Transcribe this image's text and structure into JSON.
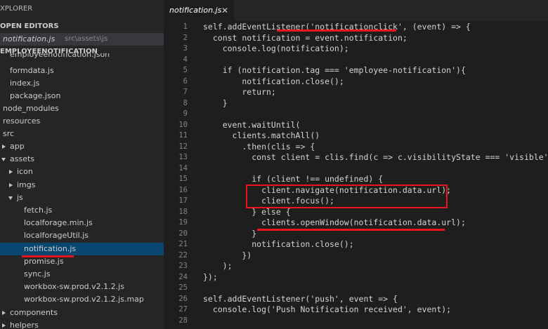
{
  "sidebar": {
    "explorer_title": "XPLORER",
    "open_editors_title": "OPEN EDITORS",
    "open_file": {
      "name": "notification.js",
      "path": "src\\assets\\js"
    },
    "project_title": "EMPLOYEENOTIFICATION",
    "items": [
      {
        "label": "employeenotification.json"
      },
      {
        "label": "formdata.js"
      },
      {
        "label": "index.js"
      },
      {
        "label": "package.json"
      },
      {
        "label": "node_modules"
      },
      {
        "label": "resources"
      },
      {
        "label": "src"
      },
      {
        "label": "app"
      },
      {
        "label": "assets"
      },
      {
        "label": "icon"
      },
      {
        "label": "imgs"
      },
      {
        "label": "js"
      },
      {
        "label": "fetch.js"
      },
      {
        "label": "localforage.min.js"
      },
      {
        "label": "localforageUtil.js"
      },
      {
        "label": "notification.js"
      },
      {
        "label": "promise.js"
      },
      {
        "label": "sync.js"
      },
      {
        "label": "workbox-sw.prod.v2.1.2.js"
      },
      {
        "label": "workbox-sw.prod.v2.1.2.js.map"
      },
      {
        "label": "components"
      },
      {
        "label": "helpers"
      }
    ]
  },
  "editor": {
    "tab": {
      "label": "notification.js",
      "close": "✕"
    },
    "line_numbers": [
      "1",
      "2",
      "3",
      "4",
      "5",
      "6",
      "7",
      "8",
      "9",
      "10",
      "11",
      "12",
      "13",
      "14",
      "15",
      "16",
      "17",
      "18",
      "19",
      "20",
      "21",
      "22",
      "23",
      "24",
      "25",
      "26",
      "27",
      "28"
    ],
    "lines": [
      "self.addEventListener('notificationclick', (event) => {",
      "  const notification = event.notification;",
      "    console.log(notification);",
      "",
      "    if (notification.tag === 'employee-notification'){",
      "        notification.close();",
      "        return;",
      "    }",
      "",
      "    event.waitUntil(",
      "      clients.matchAll()",
      "        .then(clis => {",
      "          const client = clis.find(c => c.visibilityState === 'visible');",
      "",
      "          if (client !== undefined) {",
      "            client.navigate(notification.data.url);",
      "            client.focus();",
      "          } else {",
      "            clients.openWindow(notification.data.url);",
      "          }",
      "          notification.close();",
      "        })",
      "    );",
      "});",
      "",
      "self.addEventListener('push', event => {",
      "  console.log('Push Notification received', event);",
      ""
    ]
  },
  "colors": {
    "annotation": "#e8161c",
    "selection": "#094771",
    "keyword": "#569cd6",
    "string": "#ce9178"
  }
}
